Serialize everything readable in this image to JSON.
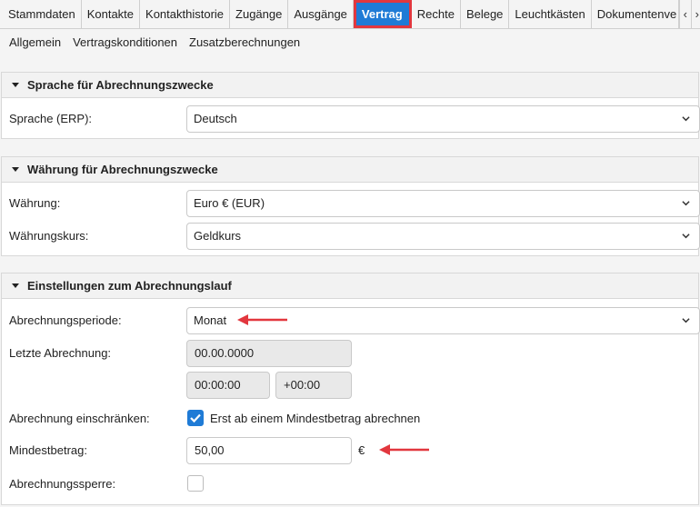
{
  "tabs": [
    {
      "label": "Stammdaten"
    },
    {
      "label": "Kontakte"
    },
    {
      "label": "Kontakthistorie"
    },
    {
      "label": "Zugänge"
    },
    {
      "label": "Ausgänge"
    },
    {
      "label": "Vertrag"
    },
    {
      "label": "Rechte"
    },
    {
      "label": "Belege"
    },
    {
      "label": "Leuchtkästen"
    },
    {
      "label": "Dokumentenve"
    }
  ],
  "subnav": [
    "Allgemein",
    "Vertragskonditionen",
    "Zusatzberechnungen"
  ],
  "language_section": {
    "title": "Sprache für Abrechnungszwecke",
    "language_label": "Sprache (ERP):",
    "language_value": "Deutsch"
  },
  "currency_section": {
    "title": "Währung für Abrechnungszwecke",
    "currency_label": "Währung:",
    "currency_value": "Euro € (EUR)",
    "rate_label": "Währungskurs:",
    "rate_value": "Geldkurs"
  },
  "billing_section": {
    "title": "Einstellungen zum Abrechnungslauf",
    "period_label": "Abrechnungsperiode:",
    "period_value": "Monat",
    "last_label": "Letzte Abrechnung:",
    "last_date": "00.00.0000",
    "last_time": "00:00:00",
    "last_tz": "+00:00",
    "restrict_label": "Abrechnung einschränken:",
    "restrict_checked": true,
    "restrict_text": "Erst ab einem Mindestbetrag abrechnen",
    "minimum_label": "Mindestbetrag:",
    "minimum_value": "50,00",
    "minimum_unit": "€",
    "block_label": "Abrechnungssperre:",
    "block_checked": false
  },
  "colors": {
    "accent": "#1f7bd6",
    "highlight": "#e2373e"
  }
}
